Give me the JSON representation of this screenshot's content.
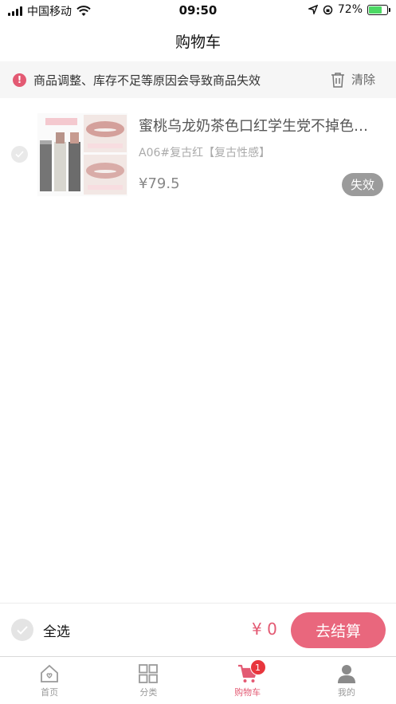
{
  "status_bar": {
    "carrier": "中国移动",
    "time": "09:50",
    "battery": "72%"
  },
  "header": {
    "title": "购物车"
  },
  "notice": {
    "icon": "alert-icon",
    "text": "商品调整、库存不足等原因会导致商品失效",
    "clear_label": "清除"
  },
  "cart": {
    "items": [
      {
        "title": "蜜桃乌龙奶茶色口红学生党不掉色…",
        "spec": "A06#复古红【复古性感】",
        "price": "¥79.5",
        "status": "失效"
      }
    ]
  },
  "bottom_bar": {
    "select_all_label": "全选",
    "total": "¥ 0",
    "checkout_label": "去结算"
  },
  "tabs": [
    {
      "label": "首页",
      "icon": "home-icon"
    },
    {
      "label": "分类",
      "icon": "grid-icon"
    },
    {
      "label": "购物车",
      "icon": "cart-icon",
      "badge": "1"
    },
    {
      "label": "我的",
      "icon": "user-icon"
    }
  ],
  "colors": {
    "accent": "#e35a73",
    "checkout": "#e9677d",
    "badge": "#e8363d",
    "battery_fill": "#4cd964"
  }
}
